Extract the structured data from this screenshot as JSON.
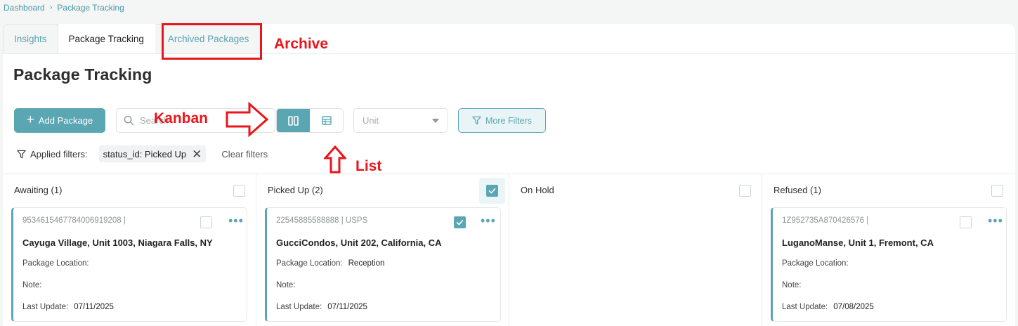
{
  "breadcrumb": {
    "items": [
      "Dashboard",
      "Package Tracking"
    ],
    "separator": "›"
  },
  "tabs": [
    {
      "label": "Insights"
    },
    {
      "label": "Package Tracking"
    },
    {
      "label": "Archived Packages"
    }
  ],
  "page": {
    "title": "Package Tracking"
  },
  "toolbar": {
    "add_label": "Add Package",
    "search_placeholder": "Search",
    "unit_placeholder": "Unit",
    "more_filters_label": "More Filters",
    "view_selected": "kanban"
  },
  "filters": {
    "label": "Applied filters:",
    "chips": [
      "status_id: Picked Up"
    ],
    "clear_label": "Clear filters"
  },
  "columns": [
    {
      "title": "Awaiting (1)",
      "checked": false,
      "cards": [
        {
          "code": "9534615467784006919208 |",
          "address": "Cayuga Village, Unit 1003, Niagara Falls, NY",
          "location_label": "Package Location:",
          "location": "",
          "note_label": "Note:",
          "note": "",
          "update_label": "Last Update:",
          "update": "07/11/2025",
          "checked": false
        }
      ]
    },
    {
      "title": "Picked Up (2)",
      "checked": true,
      "cards": [
        {
          "code": "22545885588888 | USPS",
          "address": "GucciCondos, Unit 202, California, CA",
          "location_label": "Package Location:",
          "location": "Reception",
          "note_label": "Note:",
          "note": "",
          "update_label": "Last Update:",
          "update": "07/11/2025",
          "checked": true
        }
      ]
    },
    {
      "title": "On Hold",
      "checked": false,
      "cards": []
    },
    {
      "title": "Refused (1)",
      "checked": false,
      "cards": [
        {
          "code": "1Z952735A870426576 |",
          "address": "LuganoManse, Unit 1, Fremont, CA",
          "location_label": "Package Location:",
          "location": "",
          "note_label": "Note:",
          "note": "",
          "update_label": "Last Update:",
          "update": "07/08/2025",
          "checked": false
        }
      ]
    }
  ],
  "annotations": {
    "archive": "Archive",
    "kanban": "Kanban",
    "list": "List"
  },
  "colors": {
    "accent": "#5ba6b3",
    "annotation": "#e8161b"
  }
}
